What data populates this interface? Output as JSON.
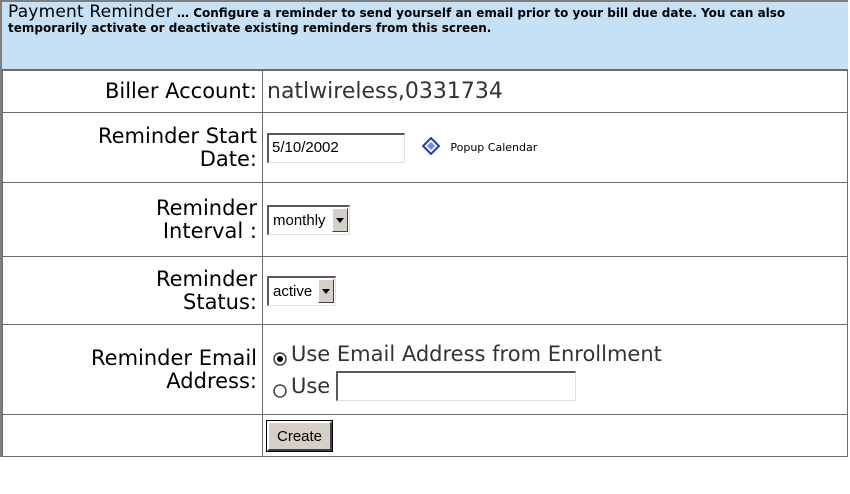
{
  "header": {
    "title": "Payment Reminder",
    "description": " … Configure a reminder to send yourself an email prior to your bill due date. You can also temporarily activate or deactivate existing reminders from this screen."
  },
  "biller_account": {
    "label": "Biller Account:",
    "value": "natlwireless,0331734"
  },
  "start_date": {
    "label_line1": "Reminder Start",
    "label_line2": "Date:",
    "value": "5/10/2002",
    "calendar_label": "Popup Calendar"
  },
  "interval": {
    "label_line1": "Reminder",
    "label_line2": "Interval :",
    "selected": "monthly"
  },
  "status": {
    "label_line1": "Reminder",
    "label_line2": "Status:",
    "selected": "active"
  },
  "email": {
    "label_line1": "Reminder Email",
    "label_line2": "Address:",
    "option_enrollment": "Use Email Address from Enrollment",
    "option_custom": "Use",
    "custom_value": ""
  },
  "create_button": "Create"
}
